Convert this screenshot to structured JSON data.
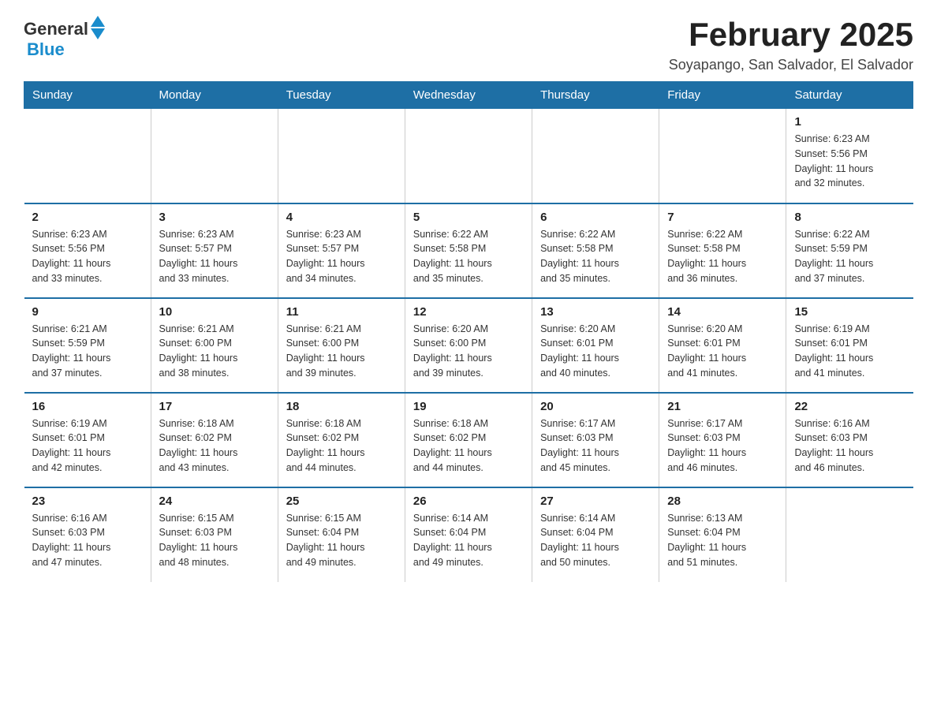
{
  "header": {
    "logo_general": "General",
    "logo_blue": "Blue",
    "month_year": "February 2025",
    "location": "Soyapango, San Salvador, El Salvador"
  },
  "days_of_week": [
    "Sunday",
    "Monday",
    "Tuesday",
    "Wednesday",
    "Thursday",
    "Friday",
    "Saturday"
  ],
  "weeks": [
    [
      {
        "day": "",
        "info": ""
      },
      {
        "day": "",
        "info": ""
      },
      {
        "day": "",
        "info": ""
      },
      {
        "day": "",
        "info": ""
      },
      {
        "day": "",
        "info": ""
      },
      {
        "day": "",
        "info": ""
      },
      {
        "day": "1",
        "info": "Sunrise: 6:23 AM\nSunset: 5:56 PM\nDaylight: 11 hours\nand 32 minutes."
      }
    ],
    [
      {
        "day": "2",
        "info": "Sunrise: 6:23 AM\nSunset: 5:56 PM\nDaylight: 11 hours\nand 33 minutes."
      },
      {
        "day": "3",
        "info": "Sunrise: 6:23 AM\nSunset: 5:57 PM\nDaylight: 11 hours\nand 33 minutes."
      },
      {
        "day": "4",
        "info": "Sunrise: 6:23 AM\nSunset: 5:57 PM\nDaylight: 11 hours\nand 34 minutes."
      },
      {
        "day": "5",
        "info": "Sunrise: 6:22 AM\nSunset: 5:58 PM\nDaylight: 11 hours\nand 35 minutes."
      },
      {
        "day": "6",
        "info": "Sunrise: 6:22 AM\nSunset: 5:58 PM\nDaylight: 11 hours\nand 35 minutes."
      },
      {
        "day": "7",
        "info": "Sunrise: 6:22 AM\nSunset: 5:58 PM\nDaylight: 11 hours\nand 36 minutes."
      },
      {
        "day": "8",
        "info": "Sunrise: 6:22 AM\nSunset: 5:59 PM\nDaylight: 11 hours\nand 37 minutes."
      }
    ],
    [
      {
        "day": "9",
        "info": "Sunrise: 6:21 AM\nSunset: 5:59 PM\nDaylight: 11 hours\nand 37 minutes."
      },
      {
        "day": "10",
        "info": "Sunrise: 6:21 AM\nSunset: 6:00 PM\nDaylight: 11 hours\nand 38 minutes."
      },
      {
        "day": "11",
        "info": "Sunrise: 6:21 AM\nSunset: 6:00 PM\nDaylight: 11 hours\nand 39 minutes."
      },
      {
        "day": "12",
        "info": "Sunrise: 6:20 AM\nSunset: 6:00 PM\nDaylight: 11 hours\nand 39 minutes."
      },
      {
        "day": "13",
        "info": "Sunrise: 6:20 AM\nSunset: 6:01 PM\nDaylight: 11 hours\nand 40 minutes."
      },
      {
        "day": "14",
        "info": "Sunrise: 6:20 AM\nSunset: 6:01 PM\nDaylight: 11 hours\nand 41 minutes."
      },
      {
        "day": "15",
        "info": "Sunrise: 6:19 AM\nSunset: 6:01 PM\nDaylight: 11 hours\nand 41 minutes."
      }
    ],
    [
      {
        "day": "16",
        "info": "Sunrise: 6:19 AM\nSunset: 6:01 PM\nDaylight: 11 hours\nand 42 minutes."
      },
      {
        "day": "17",
        "info": "Sunrise: 6:18 AM\nSunset: 6:02 PM\nDaylight: 11 hours\nand 43 minutes."
      },
      {
        "day": "18",
        "info": "Sunrise: 6:18 AM\nSunset: 6:02 PM\nDaylight: 11 hours\nand 44 minutes."
      },
      {
        "day": "19",
        "info": "Sunrise: 6:18 AM\nSunset: 6:02 PM\nDaylight: 11 hours\nand 44 minutes."
      },
      {
        "day": "20",
        "info": "Sunrise: 6:17 AM\nSunset: 6:03 PM\nDaylight: 11 hours\nand 45 minutes."
      },
      {
        "day": "21",
        "info": "Sunrise: 6:17 AM\nSunset: 6:03 PM\nDaylight: 11 hours\nand 46 minutes."
      },
      {
        "day": "22",
        "info": "Sunrise: 6:16 AM\nSunset: 6:03 PM\nDaylight: 11 hours\nand 46 minutes."
      }
    ],
    [
      {
        "day": "23",
        "info": "Sunrise: 6:16 AM\nSunset: 6:03 PM\nDaylight: 11 hours\nand 47 minutes."
      },
      {
        "day": "24",
        "info": "Sunrise: 6:15 AM\nSunset: 6:03 PM\nDaylight: 11 hours\nand 48 minutes."
      },
      {
        "day": "25",
        "info": "Sunrise: 6:15 AM\nSunset: 6:04 PM\nDaylight: 11 hours\nand 49 minutes."
      },
      {
        "day": "26",
        "info": "Sunrise: 6:14 AM\nSunset: 6:04 PM\nDaylight: 11 hours\nand 49 minutes."
      },
      {
        "day": "27",
        "info": "Sunrise: 6:14 AM\nSunset: 6:04 PM\nDaylight: 11 hours\nand 50 minutes."
      },
      {
        "day": "28",
        "info": "Sunrise: 6:13 AM\nSunset: 6:04 PM\nDaylight: 11 hours\nand 51 minutes."
      },
      {
        "day": "",
        "info": ""
      }
    ]
  ]
}
